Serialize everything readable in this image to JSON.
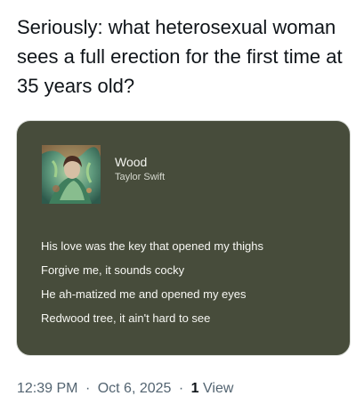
{
  "post": {
    "text": "Seriously: what heterosexual woman sees a full erection for the first time at 35 years old?"
  },
  "lyrics_card": {
    "background_color": "#474c3b",
    "album_art_icon": "album-cover-image",
    "song_title": "Wood",
    "artist": "Taylor Swift",
    "lines": [
      "His love was the key that opened my thighs",
      "Forgive me, it sounds cocky",
      "He ah-matized me and opened my eyes",
      "Redwood tree, it ain't hard to see"
    ]
  },
  "footer": {
    "time": "12:39 PM",
    "separator": "·",
    "date": "Oct 6, 2025",
    "view_count": "1",
    "view_label": "View"
  }
}
